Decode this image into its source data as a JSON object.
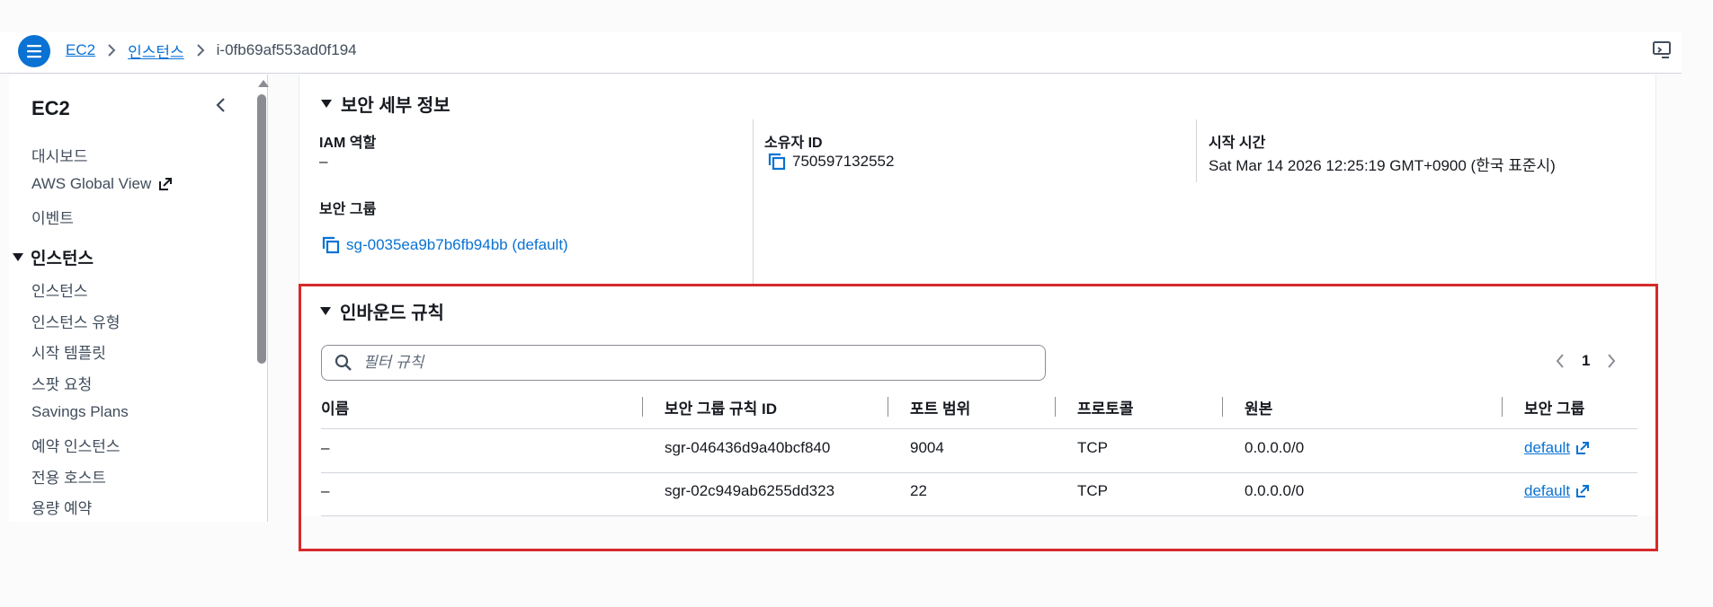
{
  "breadcrumb": {
    "items": [
      "EC2",
      "인스턴스"
    ],
    "current": "i-0fb69af553ad0f194"
  },
  "sidebar": {
    "title": "EC2",
    "items_top": [
      "대시보드",
      "AWS Global View",
      "이벤트"
    ],
    "section_instances": "인스턴스",
    "items_instances": [
      "인스턴스",
      "인스턴스 유형",
      "시작 템플릿",
      "스팟 요청",
      "Savings Plans",
      "예약 인스턴스",
      "전용 호스트",
      "용량 예약"
    ]
  },
  "security_details": {
    "heading": "보안 세부 정보",
    "iam_role_label": "IAM 역할",
    "iam_role_value": "–",
    "owner_id_label": "소유자 ID",
    "owner_id_value": "750597132552",
    "launch_time_label": "시작 시간",
    "launch_time_value": "Sat Mar 14 2026 12:25:19 GMT+0900 (한국 표준시)",
    "security_groups_label": "보안 그룹",
    "security_group_value": "sg-0035ea9b7b6fb94bb (default)"
  },
  "inbound_rules": {
    "heading": "인바운드 규칙",
    "filter_placeholder": "필터 규칙",
    "page": "1",
    "columns": [
      "이름",
      "보안 그룹 규칙 ID",
      "포트 범위",
      "프로토콜",
      "원본",
      "보안 그룹"
    ],
    "rows": [
      {
        "name": "–",
        "rule_id": "sgr-046436d9a40bcf840",
        "port": "9004",
        "protocol": "TCP",
        "source": "0.0.0.0/0",
        "group": "default"
      },
      {
        "name": "–",
        "rule_id": "sgr-02c949ab6255dd323",
        "port": "22",
        "protocol": "TCP",
        "source": "0.0.0.0/0",
        "group": "default"
      }
    ]
  },
  "colors": {
    "link": "#0972d3",
    "highlight": "#d62a2a",
    "text": "#16191f"
  }
}
